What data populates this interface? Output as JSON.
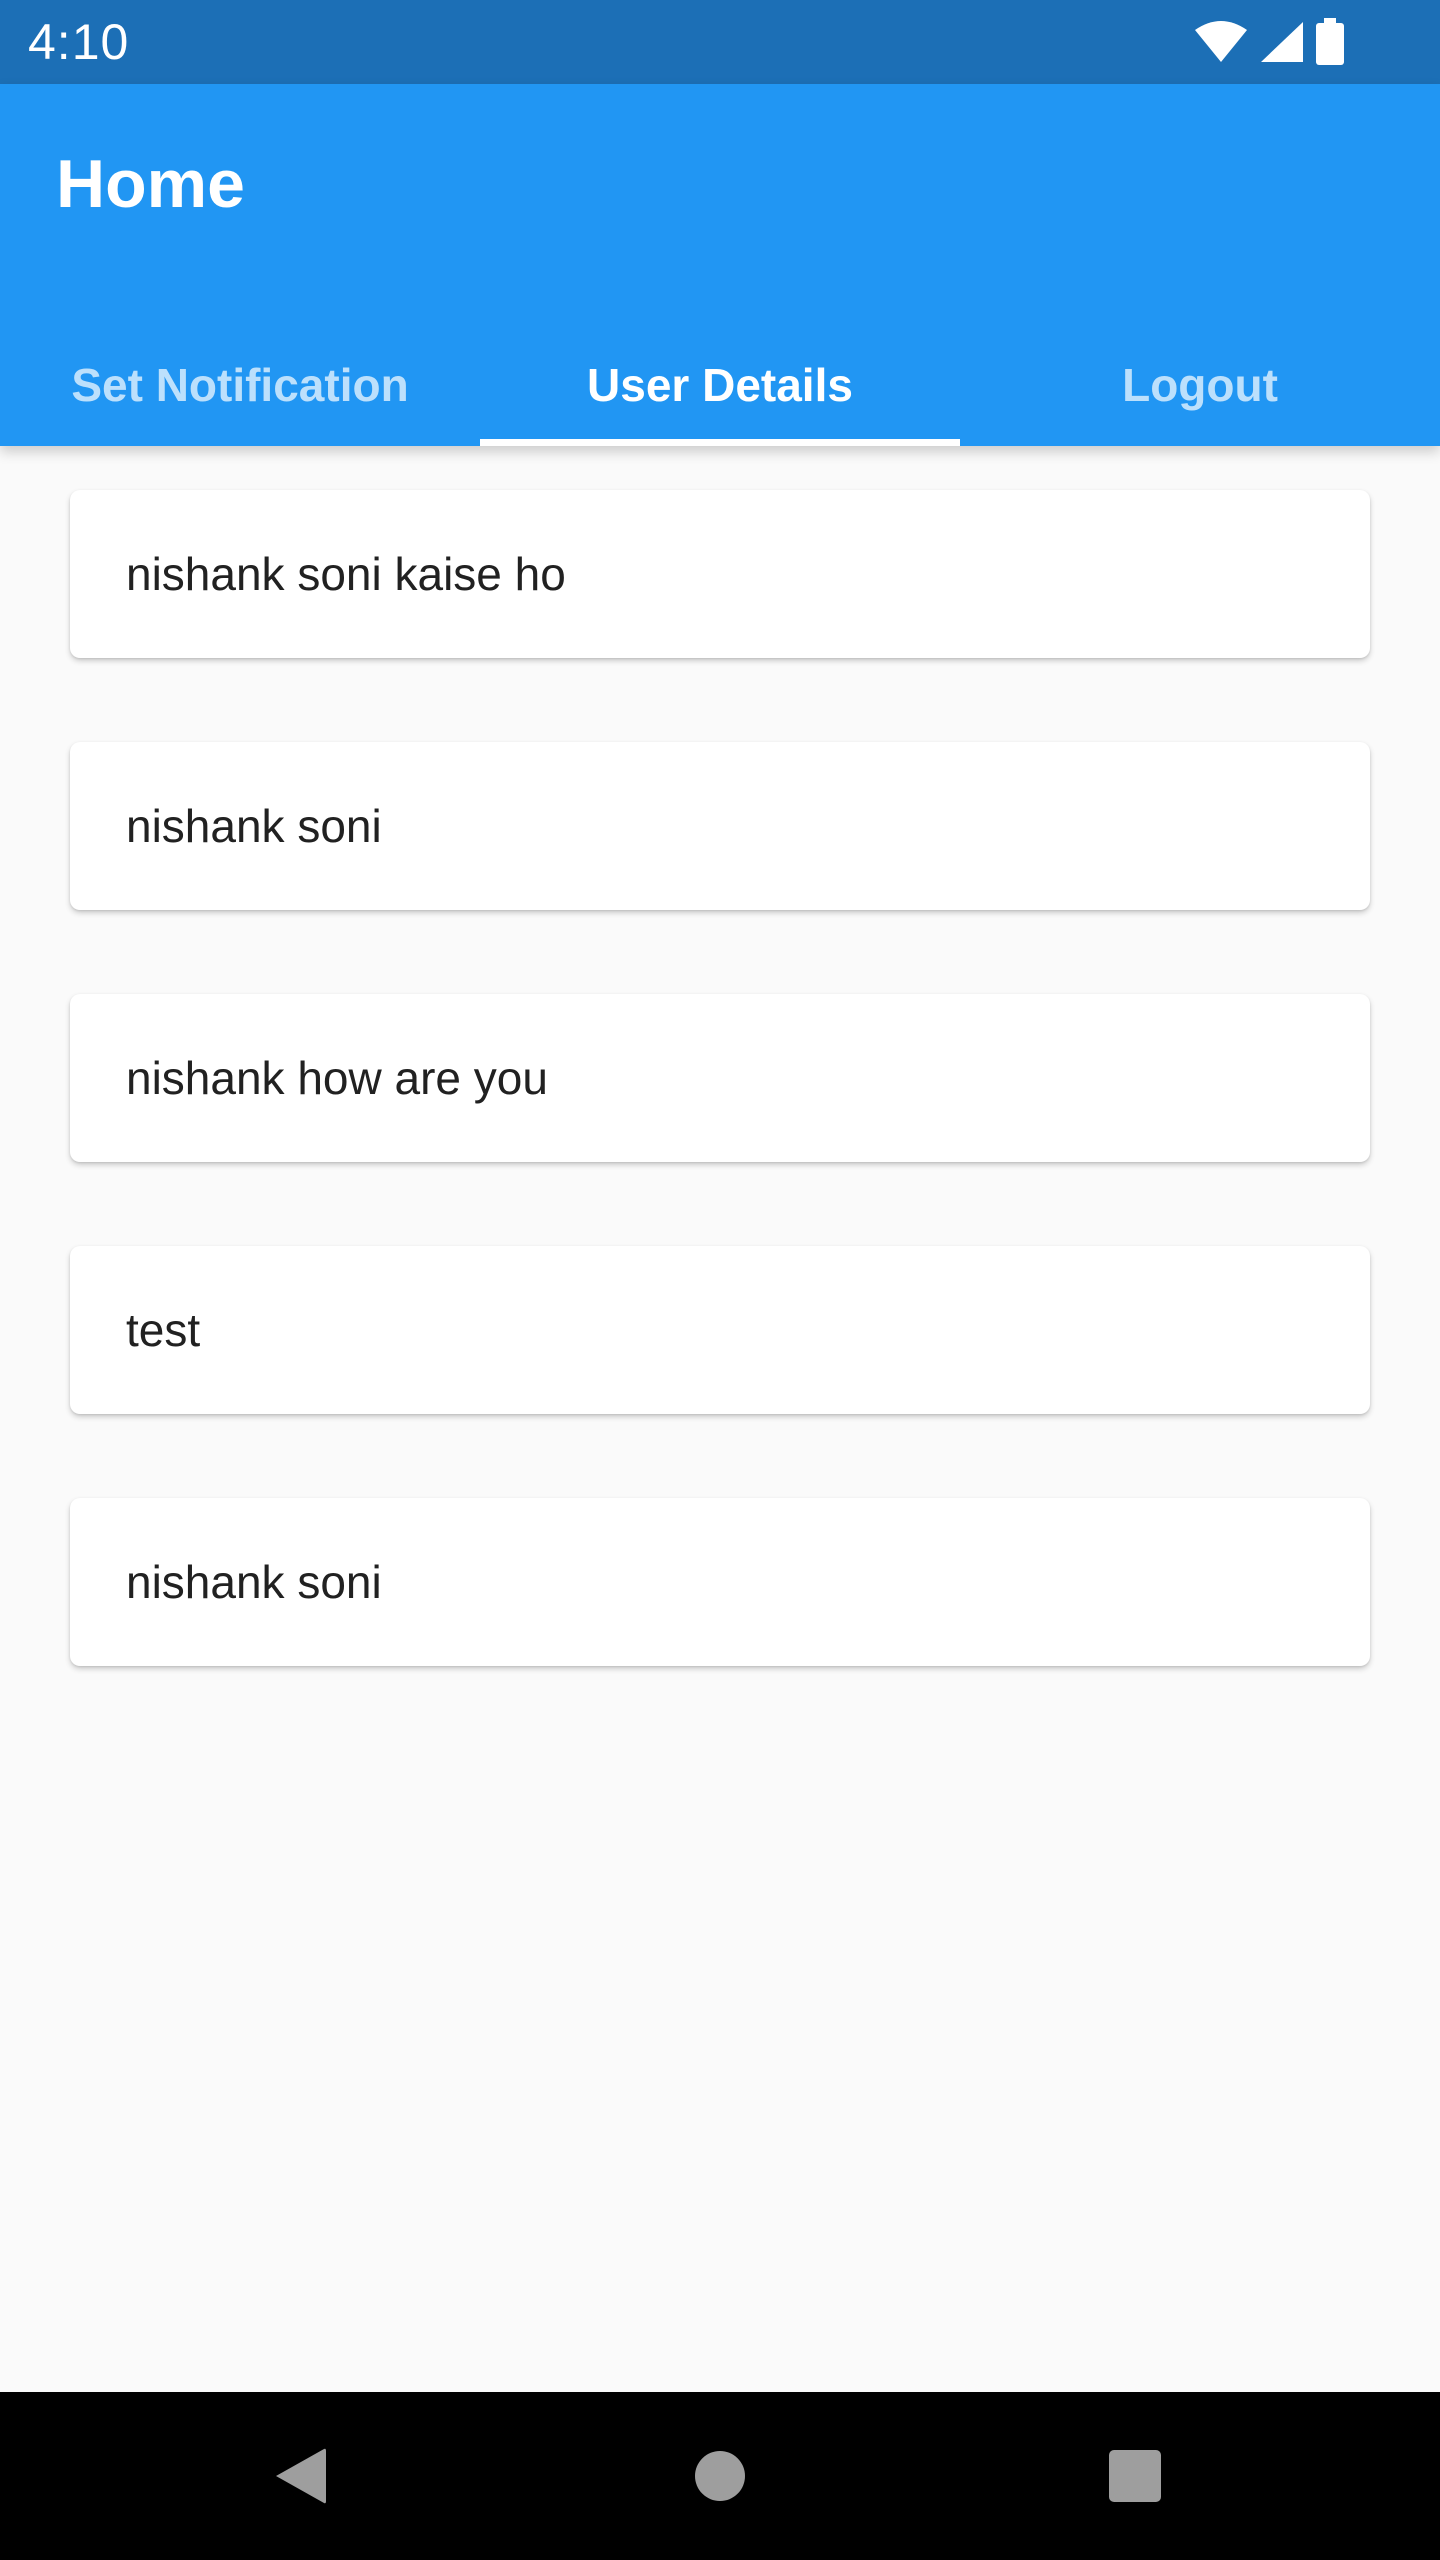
{
  "status_bar": {
    "time": "4:10",
    "icons": [
      "wifi-icon",
      "signal-icon",
      "battery-icon"
    ]
  },
  "app_bar": {
    "title": "Home",
    "tabs": [
      {
        "label": "Set Notification",
        "active": false
      },
      {
        "label": "User Details",
        "active": true
      },
      {
        "label": "Logout",
        "active": false
      }
    ]
  },
  "list": {
    "items": [
      {
        "text": "nishank soni kaise ho"
      },
      {
        "text": "nishank soni"
      },
      {
        "text": "nishank how are you"
      },
      {
        "text": "test"
      },
      {
        "text": "nishank soni"
      }
    ]
  },
  "nav_bar": {
    "buttons": [
      "back-icon",
      "home-icon",
      "recents-icon"
    ]
  },
  "colors": {
    "status_bar": "#1c6fb6",
    "app_bar": "#2196f3",
    "background": "#fafafa",
    "card": "#ffffff",
    "text": "#212121",
    "nav_bar": "#000000"
  }
}
